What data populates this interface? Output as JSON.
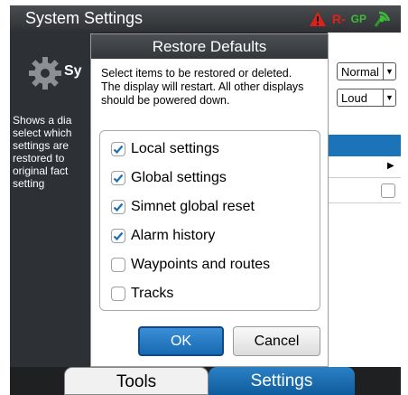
{
  "window": {
    "title": "System Settings"
  },
  "status_bar": {
    "radar_label": "R-",
    "gps_label": "GP",
    "colors": {
      "alarm": "#e0201b",
      "gps": "#3dbb3a"
    },
    "icons": [
      "alarm-icon",
      "signal-icon"
    ]
  },
  "settings_panel": {
    "heading": "Sy",
    "description": "Shows a dia\nselect which\nsettings are\nrestored to\noriginal fact\nsetting",
    "selects": [
      {
        "value": "Normal"
      },
      {
        "value": "Loud"
      }
    ]
  },
  "dialog": {
    "title": "Restore Defaults",
    "message": "Select items to be restored or deleted.\nThe display will restart. All other displays\nshould be powered down.",
    "items": [
      {
        "label": "Local settings",
        "checked": true
      },
      {
        "label": "Global settings",
        "checked": true
      },
      {
        "label": "Simnet global reset",
        "checked": true
      },
      {
        "label": "Alarm history",
        "checked": true
      },
      {
        "label": "Waypoints and routes",
        "checked": false
      },
      {
        "label": "Tracks",
        "checked": false
      }
    ],
    "ok_label": "OK",
    "cancel_label": "Cancel"
  },
  "tabs": [
    {
      "label": "Tools",
      "active": false
    },
    {
      "label": "Settings",
      "active": true
    }
  ],
  "colors": {
    "accent": "#1c73b8",
    "check": "#1a6fb5"
  }
}
